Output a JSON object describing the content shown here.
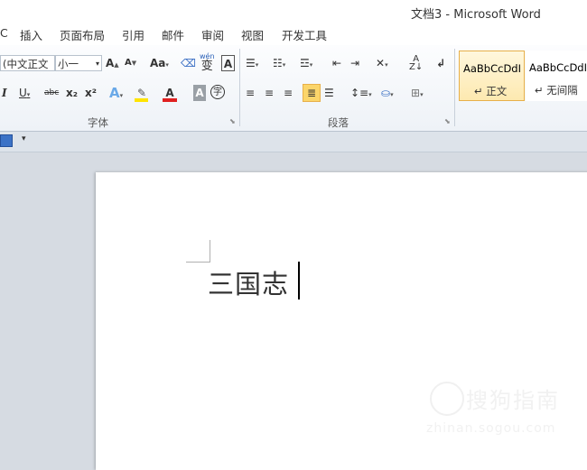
{
  "window": {
    "title": "文档3 - Microsoft Word"
  },
  "tabs": [
    {
      "label": "C"
    },
    {
      "label": "插入"
    },
    {
      "label": "页面布局"
    },
    {
      "label": "引用"
    },
    {
      "label": "邮件"
    },
    {
      "label": "审阅"
    },
    {
      "label": "视图"
    },
    {
      "label": "开发工具"
    }
  ],
  "font_group": {
    "font_name": "(中文正文",
    "font_size": "小一",
    "label": "字体",
    "icons": {
      "grow": "A",
      "shrink": "A",
      "case": "Aa",
      "phonetic": "wén",
      "phonetic_char": "变",
      "border_char": "A",
      "italic": "I",
      "underline": "U",
      "strike": "abc",
      "sub": "x₂",
      "sup": "x²",
      "effects": "A",
      "font_color": "A",
      "shading_char": "A",
      "enclose_char": "字"
    }
  },
  "paragraph_group": {
    "label": "段落"
  },
  "styles_group": {
    "styles": [
      {
        "sample": "AaBbCcDdI",
        "name": "↵ 正文",
        "active": true
      },
      {
        "sample": "AaBbCcDdI",
        "name": "↵ 无间隔",
        "active": false
      }
    ]
  },
  "document": {
    "text": "三国志"
  },
  "watermark": {
    "text": "搜狗指南",
    "url": "zhinan.sogou.com"
  },
  "colors": {
    "accent": "#e8b04a",
    "highlight": "#ffe400",
    "font_color": "#e02020"
  }
}
